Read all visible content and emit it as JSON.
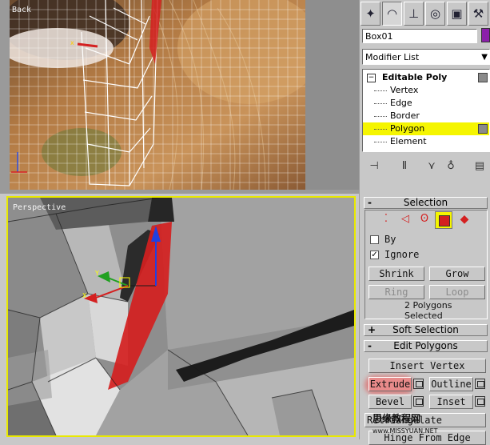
{
  "viewports": {
    "back_label": "Back",
    "perspective_label": "Perspective"
  },
  "panel": {
    "tabs": [
      "create-icon",
      "modify-icon",
      "hierarchy-icon",
      "motion-icon",
      "display-icon",
      "utilities-icon"
    ],
    "object_name": "Box01",
    "object_color": "#8b1fa9",
    "modifier_list": "Modifier List",
    "stack": {
      "root": "Editable Poly",
      "items": [
        "Vertex",
        "Edge",
        "Border",
        "Polygon",
        "Element"
      ],
      "selected": "Polygon",
      "highlight_color": "#f5f500"
    },
    "selection": {
      "title": "Selection",
      "by_label": "By",
      "ignore_label": "Ignore",
      "by_checked": false,
      "ignore_checked": true,
      "shrink": "Shrink",
      "grow": "Grow",
      "ring": "Ring",
      "loop": "Loop",
      "status": "2 Polygons Selected"
    },
    "soft_selection": {
      "title": "Soft Selection"
    },
    "edit_polygons": {
      "title": "Edit Polygons",
      "insert_vertex": "Insert Vertex",
      "extrude": "Extrude",
      "outline": "Outline",
      "bevel": "Bevel",
      "inset": "Inset",
      "retriangulate": "Retriangulate",
      "hinge_from_edge": "Hinge From Edge"
    }
  },
  "watermark": "思缘教程网",
  "watermark_url": "www.MISSYUAN.NET",
  "colors": {
    "active_viewport_border": "#e9e900",
    "extrude_glow": "#e84a4a",
    "selected_face": "#d42020"
  }
}
